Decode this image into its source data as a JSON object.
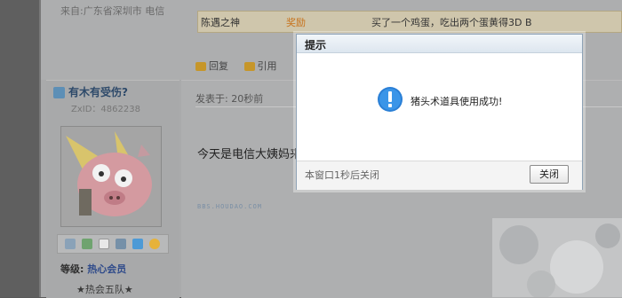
{
  "post_header": {
    "from": "来自:广东省深圳市 电信",
    "row": {
      "user": "陈遇之神",
      "tag": "奖励",
      "message": "买了一个鸡蛋，吃出两个蛋黄得3D B"
    }
  },
  "actions": {
    "reply": "回复",
    "quote": "引用"
  },
  "user": {
    "name": "有木有受伤?",
    "zxid": "ZxID：4862238",
    "level_label": "等级:",
    "level_value": "热心会员",
    "rank": "★热会五队★"
  },
  "post": {
    "posted": "发表于: 20秒前",
    "content": "今天是电信大姨妈来",
    "watermark": "BBS.HOUDAO.COM"
  },
  "dialog": {
    "title": "提示",
    "message": "猪头术道具使用成功!",
    "timer": "本窗口1秒后关闭",
    "close_label": "关闭"
  },
  "colors": {
    "accent": "#2e4a8a",
    "info_icon": "#2a7fd6"
  }
}
